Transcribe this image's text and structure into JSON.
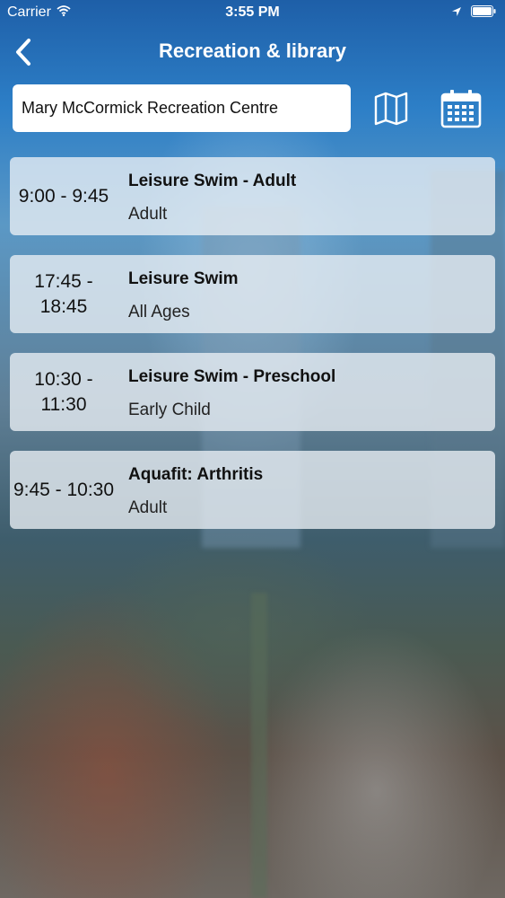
{
  "status_bar": {
    "carrier": "Carrier",
    "time": "3:55 PM"
  },
  "nav": {
    "title": "Recreation & library"
  },
  "facility": {
    "name": "Mary McCormick Recreation Centre"
  },
  "icons": {
    "back": "chevron-left-icon",
    "map": "map-icon",
    "calendar": "calendar-icon",
    "wifi": "wifi-icon",
    "location": "location-arrow-icon",
    "battery": "battery-icon"
  },
  "colors": {
    "nav_blue": "#1e5fa8",
    "card_bg": "#ebf0f5"
  },
  "sessions": [
    {
      "time": "9:00 - 9:45",
      "title": "Leisure Swim - Adult",
      "subtitle": "Adult"
    },
    {
      "time": "17:45 - 18:45",
      "title": "Leisure Swim",
      "subtitle": "All Ages"
    },
    {
      "time": "10:30 - 11:30",
      "title": "Leisure Swim - Preschool",
      "subtitle": "Early Child"
    },
    {
      "time": "9:45 - 10:30",
      "title": "Aquafit: Arthritis",
      "subtitle": "Adult"
    }
  ]
}
